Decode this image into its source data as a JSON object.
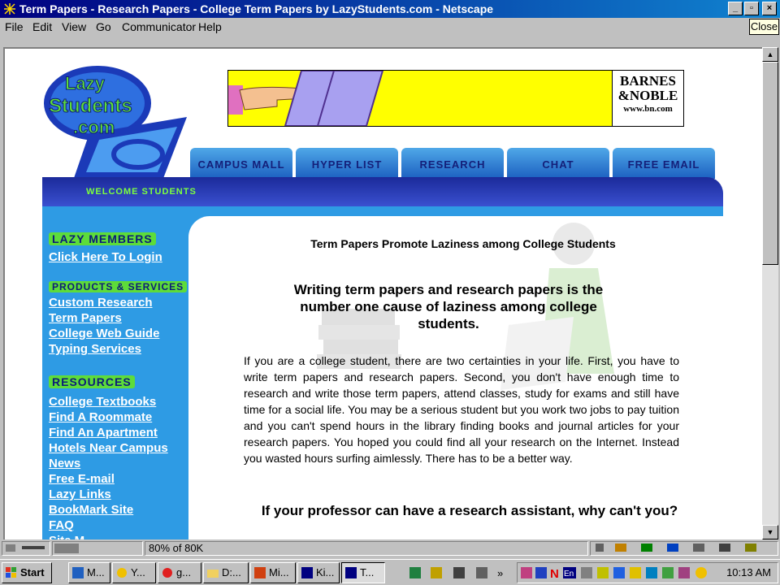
{
  "window": {
    "title": "Term Papers - Research Papers - College Term Papers by LazyStudents.com - Netscape",
    "close_tooltip": "Close"
  },
  "menu": [
    "File",
    "Edit",
    "View",
    "Go",
    "Communicator",
    "Help"
  ],
  "page": {
    "logo_text": [
      "Lazy",
      "Students",
      ".com"
    ],
    "banner": {
      "bn_line1": "BARNES",
      "bn_line2": "&NOBLE",
      "bn_url": "www.bn.com"
    },
    "tabs": [
      "CAMPUS MALL",
      "HYPER LIST",
      "RESEARCH",
      "CHAT",
      "FREE EMAIL"
    ],
    "welcome": "WELCOME STUDENTS",
    "sidebar": {
      "sections": [
        {
          "heading": "LAZY MEMBERS",
          "links": [
            "Click Here To Login"
          ]
        },
        {
          "heading": "PRODUCTS & SERVICES",
          "links": [
            "Custom Research",
            "Term Papers",
            "College Web Guide",
            "Typing Services"
          ]
        },
        {
          "heading": "RESOURCES",
          "links": [
            "College Textbooks",
            "Find A Roommate",
            "Find An Apartment",
            "Hotels Near Campus",
            "News",
            "Free E-mail",
            "Lazy Links",
            "BookMark Site",
            "FAQ",
            "Site M..."
          ]
        }
      ]
    },
    "headline_small": "Term Papers Promote Laziness among College Students",
    "headline_big": "Writing term papers and research papers is the number one cause of laziness among college students.",
    "body": "If you are a college student, there are two certainties in your life. First, you have to write term papers and research papers. Second, you don't have enough time to research and write those term papers, attend classes, study for exams and still have time for a social life. You may be a serious student but you work two jobs to pay tuition and you can't spend hours in the library finding books and journal articles for your research papers. You hoped you could find all your research on the Internet. Instead you wasted hours surfing aimlessly. There has to be a better way.",
    "headline_bottom": "If your professor can have a research assistant, why can't you?"
  },
  "status": {
    "text": "80% of 80K",
    "progress": 0.8
  },
  "taskbar": {
    "start": "Start",
    "buttons": [
      "M...",
      "Y...",
      "g...",
      "D:...",
      "Mi...",
      "Ki...",
      "T..."
    ],
    "clock": "10:13 AM"
  },
  "colors": {
    "title_bar": "#000080",
    "sidebar": "#2e9be4",
    "nav_band": "#1b2a9a",
    "accent_green": "#5ddc3a",
    "banner_yellow": "#ffff00"
  }
}
